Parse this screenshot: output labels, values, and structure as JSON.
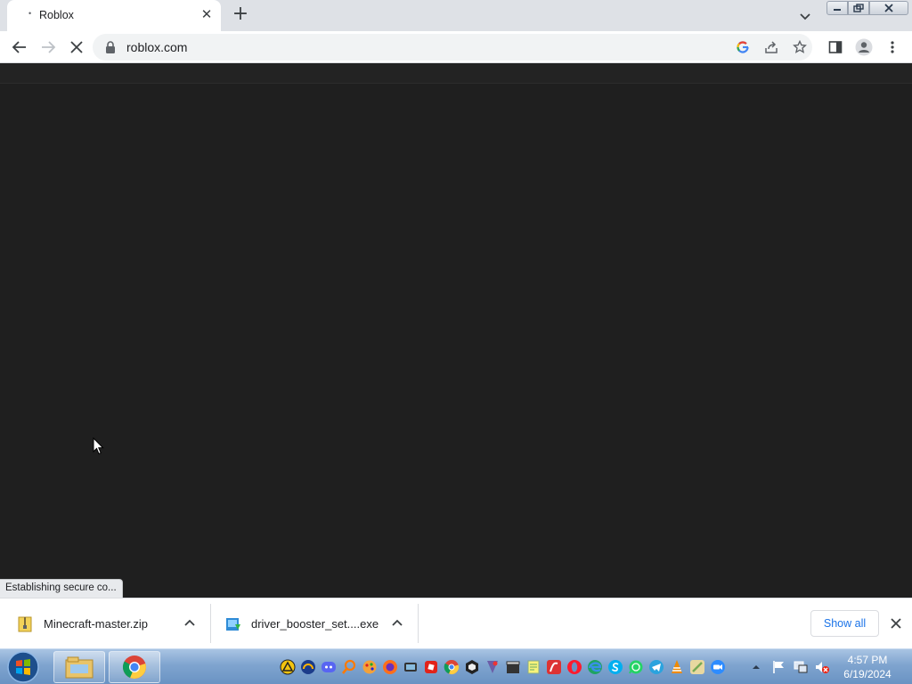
{
  "tab": {
    "title": "Roblox",
    "favicon": "loading-dot-icon",
    "close_icon": "close-icon"
  },
  "toolbar": {
    "url": "roblox.com",
    "back_icon": "back-arrow-icon",
    "forward_icon": "forward-arrow-icon",
    "stop_icon": "stop-loading-icon",
    "lock_icon": "lock-icon"
  },
  "status_text": "Establishing secure co...",
  "downloads": [
    {
      "name": "Minecraft-master.zip",
      "icon": "zip-file-icon"
    },
    {
      "name": "driver_booster_set....exe",
      "icon": "installer-file-icon"
    }
  ],
  "shelf": {
    "show_all_label": "Show all"
  },
  "taskbar": {
    "time": "4:57 PM",
    "date": "6/19/2024"
  },
  "colors": {
    "page_bg": "#1f1f1f",
    "show_all": "#1a73e8"
  }
}
